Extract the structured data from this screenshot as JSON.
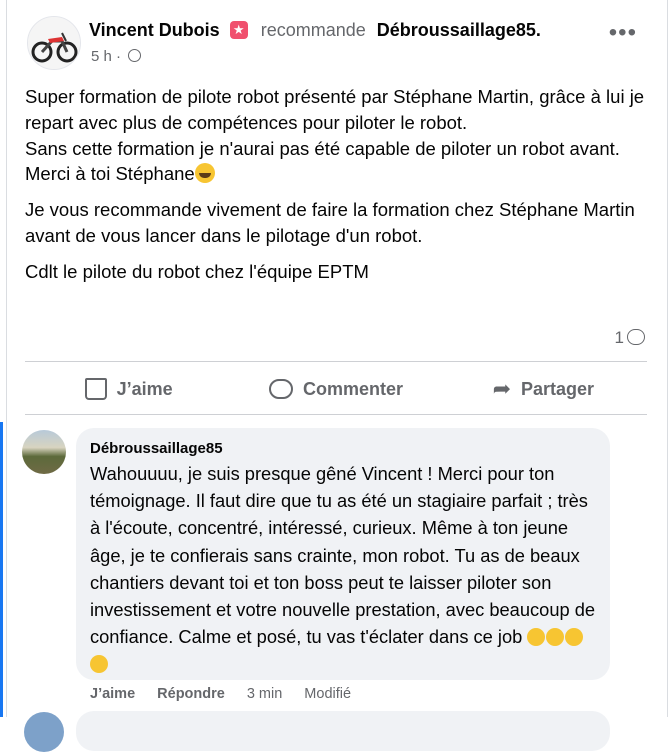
{
  "post": {
    "author": "Vincent Dubois",
    "recommends_text": "recommande",
    "page_name": "Débroussaillage85.",
    "time": "5 h",
    "separator": "·",
    "paragraphs": [
      "Super formation de pilote robot présenté par Stéphane Martin, grâce à lui je repart avec plus de compétences pour piloter le robot.",
      "Sans cette formation je n'aurai pas été capable de piloter un robot avant.",
      "Merci à toi Stéphane",
      "Je vous recommande vivement de faire la formation chez Stéphane Martin avant de vous lancer dans le pilotage d'un robot.",
      "Cdlt le pilote du robot chez l'équipe EPTM"
    ],
    "comment_count": "1"
  },
  "actions": {
    "like": "J’aime",
    "comment": "Commenter",
    "share": "Partager"
  },
  "comment": {
    "author": "Débroussaillage85",
    "text": "Wahouuuu, je suis presque gêné Vincent ! Merci pour ton témoignage. Il faut dire que tu as été un stagiaire parfait ; très à l'écoute, concentré, intéressé, curieux. Même à ton jeune âge, je te confierais sans crainte, mon robot. Tu as de beaux chantiers devant toi et ton boss peut te laisser piloter son investissement et votre nouvelle prestation, avec beaucoup de confiance. Calme et posé, tu vas t'éclater dans ce job",
    "like": "J’aime",
    "reply": "Répondre",
    "time": "3 min",
    "edited": "Modifié"
  },
  "icons": {
    "badge": "star-badge-icon",
    "privacy": "globe-icon",
    "more": "more-icon",
    "like": "thumbs-up-icon",
    "comment": "comment-bubble-icon",
    "share": "share-arrow-icon"
  },
  "colors": {
    "accent": "#1877f2",
    "secondary_text": "#65676b",
    "comment_bg": "#f0f2f5"
  }
}
